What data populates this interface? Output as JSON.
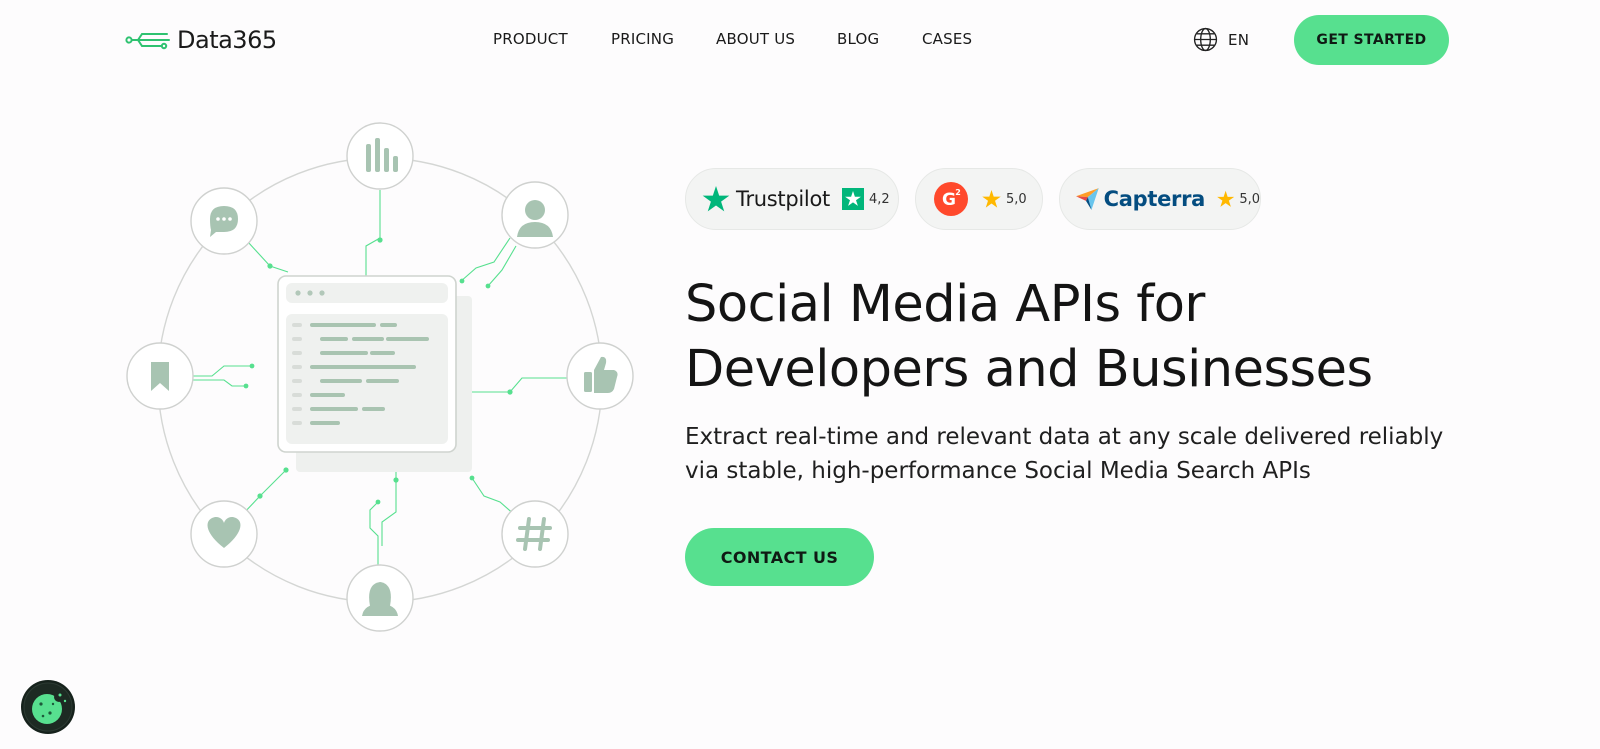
{
  "header": {
    "logo_text": "Data365",
    "nav": [
      {
        "label": "PRODUCT"
      },
      {
        "label": "PRICING"
      },
      {
        "label": "ABOUT US"
      },
      {
        "label": "BLOG"
      },
      {
        "label": "CASES"
      }
    ],
    "language": "EN",
    "cta_label": "GET STARTED"
  },
  "ratings": [
    {
      "name": "Trustpilot",
      "score": "4,2"
    },
    {
      "name": "G2",
      "score": "5,0"
    },
    {
      "name": "Capterra",
      "score": "5,0"
    }
  ],
  "hero": {
    "title_line1": "Social Media APIs for",
    "title_line2": "Developers and Businesses",
    "subtitle_line1": "Extract real-time and relevant data at any scale delivered reliably",
    "subtitle_line2": "via stable, high-performance Social Media Search APIs",
    "cta_label": "CONTACT US"
  },
  "icons": {
    "node_icons": [
      "bar-chart-icon",
      "user-icon",
      "thumbs-up-icon",
      "hashtag-icon",
      "woman-icon",
      "heart-icon",
      "bookmark-icon",
      "chat-bubble-icon"
    ],
    "cookie": "cookie-icon",
    "language": "globe-icon"
  },
  "colors": {
    "accent": "#57e08f",
    "icon_sage": "#a8c4b2",
    "line_green": "#57e08f",
    "trustpilot_green": "#00b67a",
    "g2_orange": "#ff492c",
    "capterra_blue": "#044d80",
    "star_yellow": "#ffb800"
  }
}
